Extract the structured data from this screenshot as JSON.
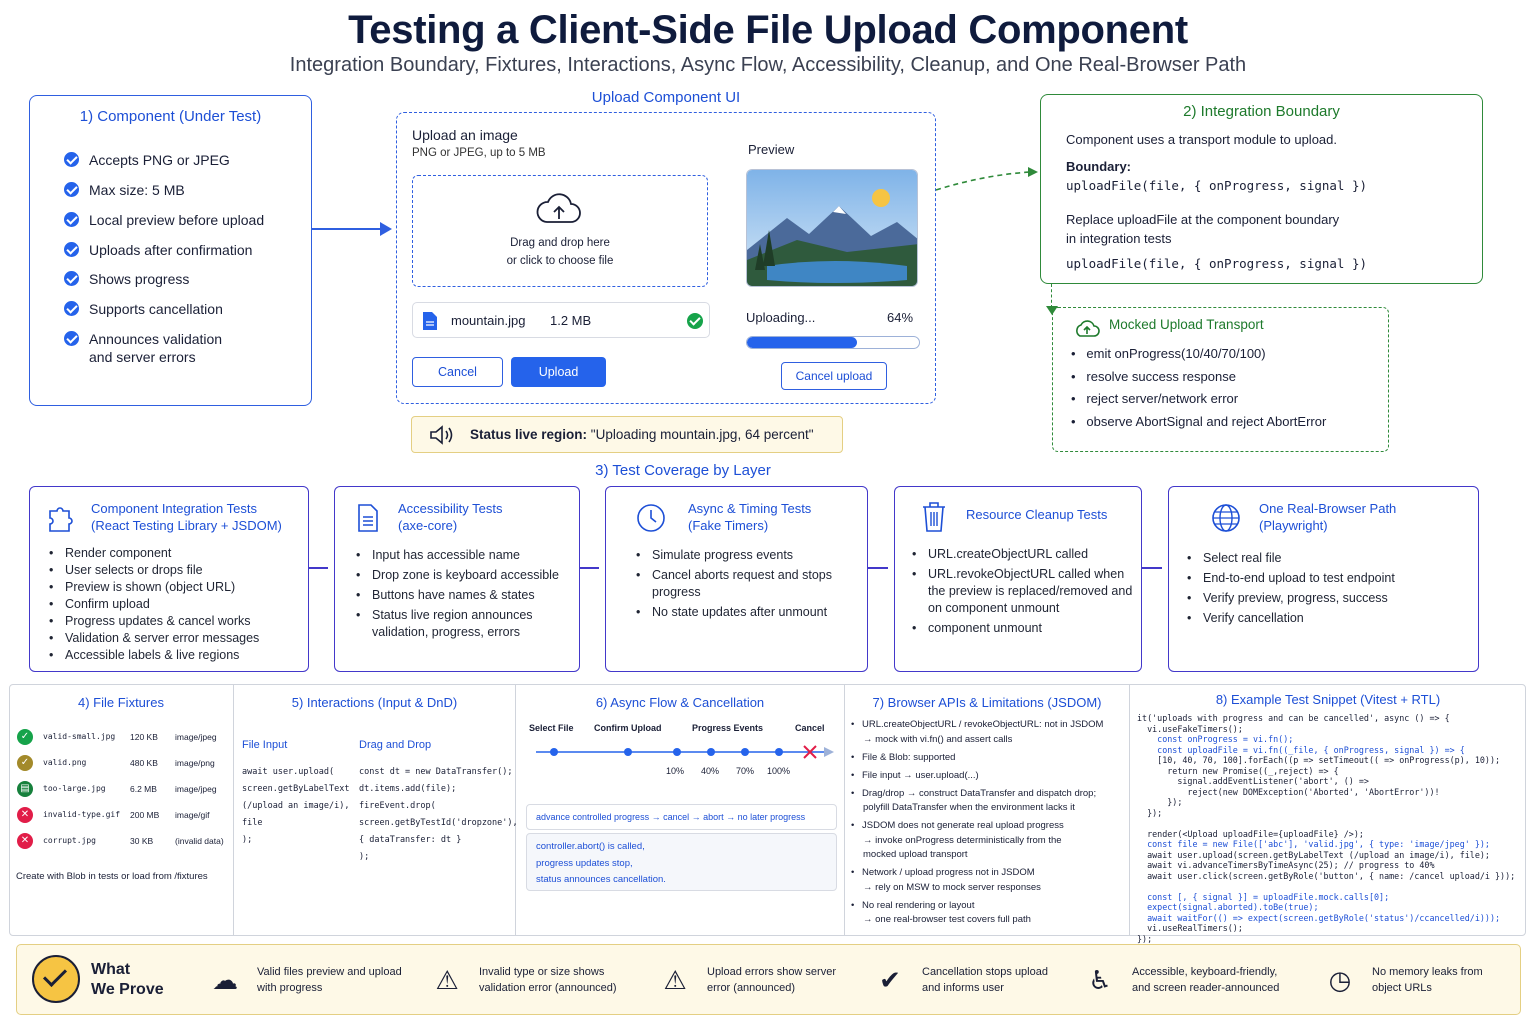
{
  "title": "Testing a Client-Side File Upload Component",
  "subtitle": "Integration Boundary, Fixtures, Interactions, Async Flow, Accessibility, Cleanup, and One Real-Browser Path",
  "component": {
    "title": "1) Component (Under Test)",
    "items": [
      "Accepts PNG or JPEG",
      "Max size: 5 MB",
      "Local preview before upload",
      "Uploads after confirmation",
      "Shows progress",
      "Supports cancellation",
      "Announces validation",
      "and server errors"
    ]
  },
  "ui": {
    "title": "Upload Component UI",
    "heading": "Upload an image",
    "hint": "PNG or JPEG, up to 5 MB",
    "drop1": "Drag and drop here",
    "drop2": "or click to choose file",
    "file_name": "mountain.jpg",
    "file_size": "1.2 MB",
    "cancel": "Cancel",
    "upload": "Upload",
    "preview": "Preview",
    "uploading": "Uploading...",
    "percent": "64%",
    "progress": 0.64,
    "cancel_upload": "Cancel upload",
    "status_label": "Status live region:",
    "status_text": "\"Uploading mountain.jpg, 64 percent\""
  },
  "boundary": {
    "title": "2) Integration Boundary",
    "line1": "Component uses a transport module to upload.",
    "label": "Boundary:",
    "code1": "uploadFile(file, { onProgress, signal })",
    "line2": "Replace uploadFile at the component boundary",
    "line3": "in integration tests",
    "code2": "uploadFile(file, { onProgress, signal })"
  },
  "mock": {
    "title": "Mocked Upload Transport",
    "items": [
      "emit onProgress(10/40/70/100)",
      "resolve success response",
      "reject server/network error",
      "observe AbortSignal and reject AbortError"
    ]
  },
  "coverage": {
    "title": "3) Test Coverage by Layer",
    "cards": [
      {
        "t1": "Component Integration Tests",
        "t2": "(React Testing Library + JSDOM)",
        "items": [
          "Render component",
          "User selects or drops file",
          "Preview is shown (object URL)",
          "Confirm upload",
          "Progress updates & cancel works",
          "Validation & server error messages",
          "Accessible labels & live regions"
        ]
      },
      {
        "t1": "Accessibility Tests",
        "t2": "(axe-core)",
        "items": [
          "Input has accessible name",
          "Drop zone is keyboard accessible",
          "Buttons have names & states",
          "Status live region announces validation, progress, errors"
        ]
      },
      {
        "t1": "Async & Timing Tests",
        "t2": "(Fake Timers)",
        "items": [
          "Simulate progress events",
          "Cancel aborts request and stops progress",
          "No state updates after unmount"
        ]
      },
      {
        "t1": "Resource Cleanup Tests",
        "t2": "",
        "items": [
          "URL.createObjectURL called",
          "URL.revokeObjectURL called when the preview is replaced/removed and on component unmount",
          "component unmount"
        ]
      },
      {
        "t1": "One Real-Browser Path",
        "t2": "(Playwright)",
        "items": [
          "Select real file",
          "End-to-end upload to test endpoint",
          "Verify preview, progress, success",
          "Verify cancellation"
        ]
      }
    ]
  },
  "fixtures": {
    "title": "4) File Fixtures",
    "rows": [
      {
        "name": "valid-small.jpg",
        "size": "120 KB",
        "type": "image/jpeg",
        "status": "ok"
      },
      {
        "name": "valid.png",
        "size": "480 KB",
        "type": "image/png",
        "status": "warn"
      },
      {
        "name": "too-large.jpg",
        "size": "6.2 MB",
        "type": "image/jpeg",
        "status": "doc"
      },
      {
        "name": "invalid-type.gif",
        "size": "200 MB",
        "type": "image/gif",
        "status": "err"
      },
      {
        "name": "corrupt.jpg",
        "size": "30 KB",
        "type": "(invalid data)",
        "status": "err"
      }
    ],
    "note": "Create with Blob in tests or load from /fixtures"
  },
  "interactions": {
    "title": "5) Interactions (Input & DnD)",
    "col1": "File Input",
    "col2": "Drag and Drop",
    "code1": [
      "await user.upload(",
      "screen.getByLabelText",
      "(/upload an image/i),",
      "file",
      ");"
    ],
    "code2": [
      "const dt = new DataTransfer();",
      "dt.items.add(file);",
      "fireEvent.drop(",
      "screen.getByTestId('dropzone'),",
      "{ dataTransfer: dt }",
      ");"
    ]
  },
  "async": {
    "title": "6) Async Flow & Cancellation",
    "steps": [
      "Select File",
      "Confirm Upload",
      "Progress Events",
      "Cancel"
    ],
    "ticks": [
      "10%",
      "40%",
      "70%",
      "100%"
    ],
    "flow": "advance controlled progress → cancel → abort → no later progress",
    "note1": "controller.abort() is called,",
    "note2": "progress updates stop,",
    "note3": "status announces cancellation."
  },
  "browser": {
    "title": "7) Browser APIs & Limitations (JSDOM)",
    "items": [
      [
        "URL.createObjectURL / revokeObjectURL: not in JSDOM",
        "→ mock with vi.fn() and assert calls"
      ],
      [
        "File & Blob: supported"
      ],
      [
        "File input → user.upload(...)"
      ],
      [
        "Drag/drop → construct DataTransfer and dispatch drop;",
        "polyfill DataTransfer when the environment lacks it"
      ],
      [
        "JSDOM does not generate real upload progress",
        "→ invoke onProgress deterministically from the",
        "mocked upload transport"
      ],
      [
        "Network / upload progress not in JSDOM",
        "→ rely on MSW to mock server responses"
      ],
      [
        "No real rendering or layout",
        "→ one real-browser test covers full path"
      ]
    ]
  },
  "snippet": {
    "title": "8) Example Test Snippet (Vitest + RTL)",
    "lines": [
      "it('uploads with progress and can be cancelled', async () => {",
      "  vi.useFakeTimers();",
      "    const onProgress = vi.fn();",
      "    const uploadFile = vi.fn((_file, { onProgress, signal }) => {",
      "    [10, 40, 70, 100].forEach((p => setTimeout(( => onProgress(p), 10));",
      "      return new Promise((_,reject) => {",
      "        signal.addEventListener('abort', () =>",
      "          reject(new DOMException('Aborted', 'AbortError'))!",
      "      });",
      "  });",
      "",
      "  render(<Upload uploadFile={uploadFile} />);",
      "  const file = new File(['abc'], 'valid.jpg', { type: 'image/jpeg' });",
      "  await user.upload(screen.getByLabelText (/upload an image/i), file);",
      "  await vi.advanceTimersByTimeAsync(25); // progress to 40%",
      "  await user.click(screen.getByRole('button', { name: /cancel upload/i }));",
      "",
      "  const [, { signal }] = uploadFile.mock.calls[0];",
      "  expect(signal.aborted).toBe(true);",
      "  await waitFor(() => expect(screen.getByRole('status')/ccancelled/i)));",
      "  vi.useRealTimers();",
      "});"
    ]
  },
  "prove": {
    "title1": "What",
    "title2": "We Prove",
    "items": [
      [
        "Valid files preview and upload",
        "with progress"
      ],
      [
        "Invalid type or size shows",
        "validation error (announced)"
      ],
      [
        "Upload errors show server",
        "error (announced)"
      ],
      [
        "Cancellation stops upload",
        "and informs user"
      ],
      [
        "Accessible, keyboard-friendly,",
        "and screen reader-announced"
      ],
      [
        "No memory leaks from",
        "object URLs"
      ]
    ]
  },
  "colors": {
    "blue": "#2f5fe0",
    "green": "#2f8a3a",
    "indigo": "#4338ca",
    "yellow": "#fef9e7"
  }
}
